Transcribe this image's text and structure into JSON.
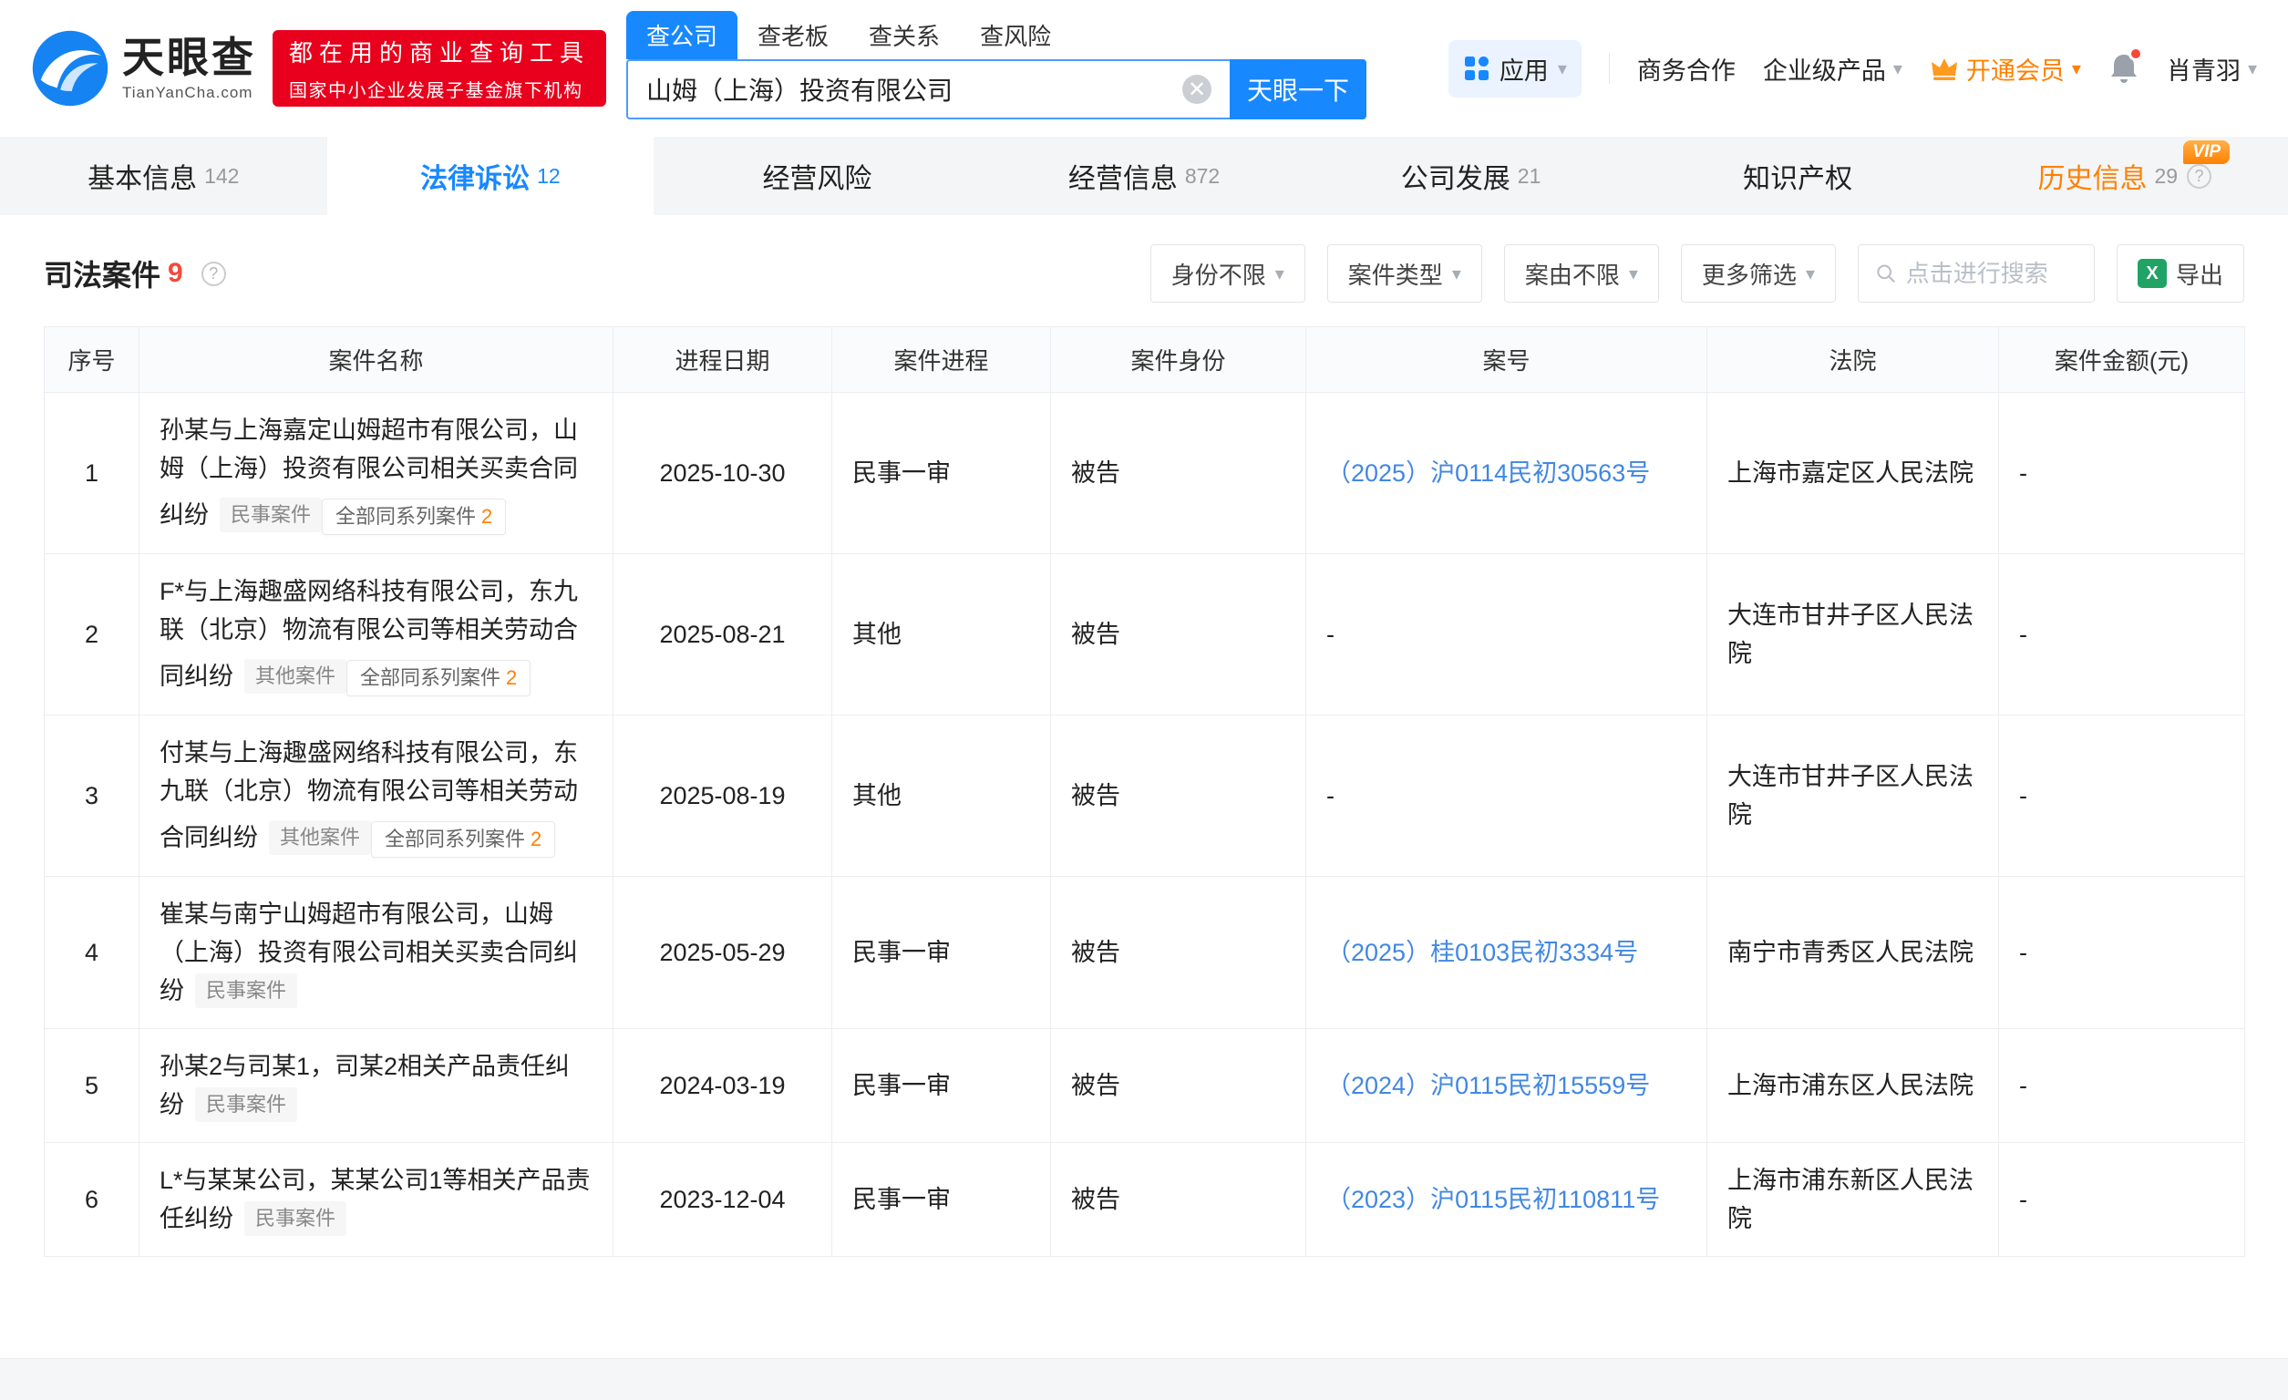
{
  "brand": {
    "name": "天眼查",
    "domain": "TianYanCha.com",
    "slogan_line1": "都在用的商业查询工具",
    "slogan_line2": "国家中小企业发展子基金旗下机构"
  },
  "search": {
    "tabs": [
      {
        "key": "company",
        "label": "查公司",
        "active": true
      },
      {
        "key": "boss",
        "label": "查老板",
        "active": false
      },
      {
        "key": "relation",
        "label": "查关系",
        "active": false
      },
      {
        "key": "risk",
        "label": "查风险",
        "active": false
      }
    ],
    "value": "山姆（上海）投资有限公司",
    "button": "天眼一下"
  },
  "top_nav": {
    "apps": "应用",
    "biz_coop": "商务合作",
    "enterprise": "企业级产品",
    "vip": "开通会员",
    "username": "肖青羽"
  },
  "tabs": [
    {
      "key": "basic-info",
      "label": "基本信息",
      "count": "142",
      "active": false
    },
    {
      "key": "legal-proceedings",
      "label": "法律诉讼",
      "count": "12",
      "active": true
    },
    {
      "key": "operational-risk",
      "label": "经营风险",
      "count": "",
      "active": false
    },
    {
      "key": "business-info",
      "label": "经营信息",
      "count": "872",
      "active": false
    },
    {
      "key": "company-development",
      "label": "公司发展",
      "count": "21",
      "active": false
    },
    {
      "key": "intellectual-property",
      "label": "知识产权",
      "count": "",
      "active": false
    },
    {
      "key": "historical-info",
      "label": "历史信息",
      "count": "29",
      "active": false,
      "vip": true,
      "help": true
    }
  ],
  "section": {
    "title": "司法案件",
    "count": "9"
  },
  "filters": {
    "identity": "身份不限",
    "case_type": "案件类型",
    "cause": "案由不限",
    "more": "更多筛选",
    "search_placeholder": "点击进行搜索",
    "export": "导出"
  },
  "table": {
    "headers": [
      "序号",
      "案件名称",
      "进程日期",
      "案件进程",
      "案件身份",
      "案号",
      "法院",
      "案件金额(元)"
    ],
    "rows": [
      {
        "no": "1",
        "name": "孙某与上海嘉定山姆超市有限公司，山姆（上海）投资有限公司相关买卖合同纠纷",
        "tag": "民事案件",
        "series_label": "全部同系列案件",
        "series_count": "2",
        "date": "2025-10-30",
        "progress": "民事一审",
        "role": "被告",
        "case_no": "（2025）沪0114民初30563号",
        "case_no_link": true,
        "court": "上海市嘉定区人民法院",
        "amount": "-"
      },
      {
        "no": "2",
        "name": "F*与上海趣盛网络科技有限公司，东九联（北京）物流有限公司等相关劳动合同纠纷",
        "tag": "其他案件",
        "series_label": "全部同系列案件",
        "series_count": "2",
        "date": "2025-08-21",
        "progress": "其他",
        "role": "被告",
        "case_no": "-",
        "case_no_link": false,
        "court": "大连市甘井子区人民法院",
        "amount": "-"
      },
      {
        "no": "3",
        "name": "付某与上海趣盛网络科技有限公司，东九联（北京）物流有限公司等相关劳动合同纠纷",
        "tag": "其他案件",
        "series_label": "全部同系列案件",
        "series_count": "2",
        "date": "2025-08-19",
        "progress": "其他",
        "role": "被告",
        "case_no": "-",
        "case_no_link": false,
        "court": "大连市甘井子区人民法院",
        "amount": "-"
      },
      {
        "no": "4",
        "name": "崔某与南宁山姆超市有限公司，山姆（上海）投资有限公司相关买卖合同纠纷",
        "tag": "民事案件",
        "series_label": "",
        "series_count": "",
        "date": "2025-05-29",
        "progress": "民事一审",
        "role": "被告",
        "case_no": "（2025）桂0103民初3334号",
        "case_no_link": true,
        "court": "南宁市青秀区人民法院",
        "amount": "-"
      },
      {
        "no": "5",
        "name": "孙某2与司某1，司某2相关产品责任纠纷",
        "tag": "民事案件",
        "series_label": "",
        "series_count": "",
        "date": "2024-03-19",
        "progress": "民事一审",
        "role": "被告",
        "case_no": "（2024）沪0115民初15559号",
        "case_no_link": true,
        "court": "上海市浦东区人民法院",
        "amount": "-"
      },
      {
        "no": "6",
        "name": "L*与某某公司，某某公司1等相关产品责任纠纷",
        "tag": "民事案件",
        "series_label": "",
        "series_count": "",
        "date": "2023-12-04",
        "progress": "民事一审",
        "role": "被告",
        "case_no": "（2023）沪0115民初110811号",
        "case_no_link": true,
        "court": "上海市浦东新区人民法院",
        "amount": "-"
      }
    ]
  }
}
